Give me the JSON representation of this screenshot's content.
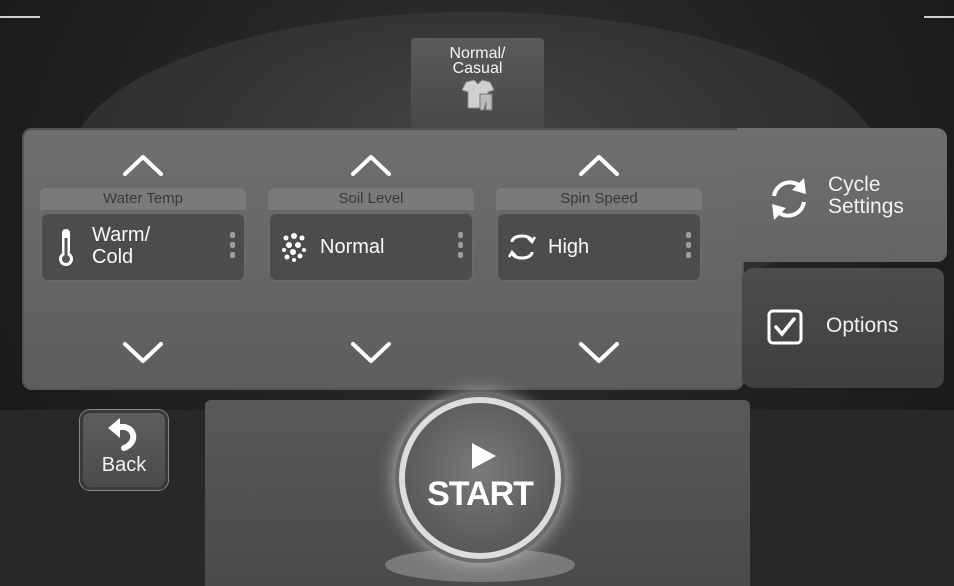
{
  "cycle": {
    "label": "Normal/\nCasual",
    "icon": "clothes-icon"
  },
  "controls": [
    {
      "header": "Water Temp",
      "value": "Warm/\nCold",
      "icon": "thermometer-icon"
    },
    {
      "header": "Soil Level",
      "value": "Normal",
      "icon": "soil-icon"
    },
    {
      "header": "Spin Speed",
      "value": "High",
      "icon": "spin-icon"
    }
  ],
  "side": {
    "cycle_settings": "Cycle\nSettings",
    "options": "Options"
  },
  "buttons": {
    "back": "Back",
    "start": "START"
  },
  "colors": {
    "panel": "#666666",
    "background": "#1e1e1e",
    "text": "#f2f2f2"
  }
}
